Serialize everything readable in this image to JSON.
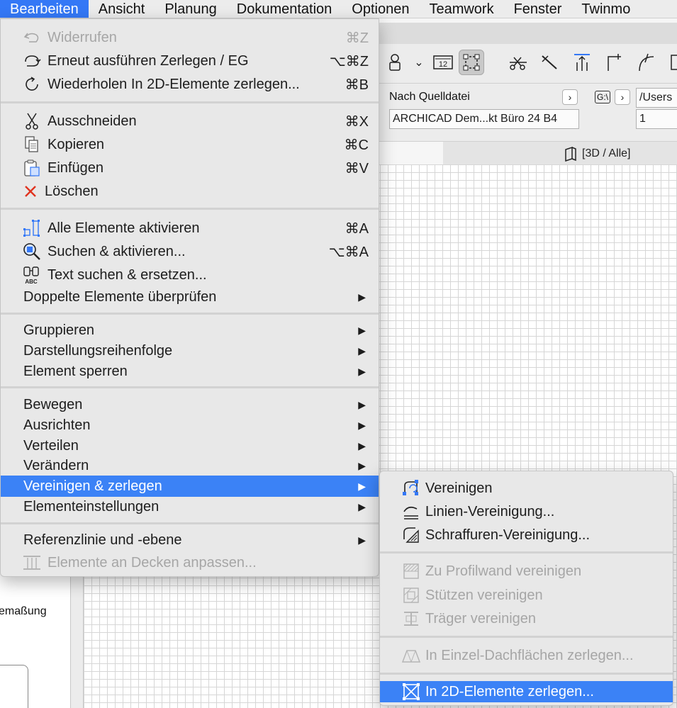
{
  "menubar": {
    "items": [
      {
        "label": "Bearbeiten",
        "active": true
      },
      {
        "label": "Ansicht"
      },
      {
        "label": "Planung"
      },
      {
        "label": "Dokumentation"
      },
      {
        "label": "Optionen"
      },
      {
        "label": "Teamwork"
      },
      {
        "label": "Fenster"
      },
      {
        "label": "Twinmo"
      }
    ]
  },
  "edit_menu": {
    "undo": {
      "label": "Widerrufen",
      "shortcut": "⌘Z",
      "icon": "undo-icon",
      "enabled": false
    },
    "redo": {
      "label": "Erneut ausführen Zerlegen / EG",
      "shortcut": "⌥⌘Z",
      "icon": "redo-icon"
    },
    "repeat": {
      "label": "Wiederholen In 2D-Elemente zerlegen...",
      "shortcut": "⌘B",
      "icon": "repeat-icon"
    },
    "cut": {
      "label": "Ausschneiden",
      "shortcut": "⌘X",
      "icon": "scissors-icon"
    },
    "copy": {
      "label": "Kopieren",
      "shortcut": "⌘C",
      "icon": "copy-icon"
    },
    "paste": {
      "label": "Einfügen",
      "shortcut": "⌘V",
      "icon": "clipboard-icon"
    },
    "delete": {
      "label": "Löschen",
      "icon": "delete-x-icon"
    },
    "select_all": {
      "label": "Alle Elemente aktivieren",
      "shortcut": "⌘A",
      "icon": "select-all-icon"
    },
    "find_select": {
      "label": "Suchen & aktivieren...",
      "shortcut": "⌥⌘A",
      "icon": "find-select-icon"
    },
    "find_text": {
      "label": "Text suchen & ersetzen...",
      "icon": "binoculars-icon",
      "icon_caption": "ABC"
    },
    "duplicates": {
      "label": "Doppelte Elemente überprüfen"
    },
    "group": {
      "label": "Gruppieren"
    },
    "display_order": {
      "label": "Darstellungsreihenfolge"
    },
    "lock": {
      "label": "Element sperren"
    },
    "move": {
      "label": "Bewegen"
    },
    "align": {
      "label": "Ausrichten"
    },
    "distribute": {
      "label": "Verteilen"
    },
    "reshape": {
      "label": "Verändern"
    },
    "merge_explode": {
      "label": "Vereinigen & zerlegen",
      "highlighted": true
    },
    "element_settings": {
      "label": "Elementeinstellungen"
    },
    "reference": {
      "label": "Referenzlinie und -ebene"
    },
    "adjust_slabs": {
      "label": "Elemente an Decken anpassen...",
      "icon": "adjust-slabs-icon",
      "enabled": false
    }
  },
  "submenu": {
    "merge": {
      "label": "Vereinigen",
      "icon": "merge-icon"
    },
    "line_merge": {
      "label": "Linien-Vereinigung...",
      "icon": "line-merge-icon"
    },
    "fill_merge": {
      "label": "Schraffuren-Vereinigung...",
      "icon": "fill-merge-icon"
    },
    "profile_wall": {
      "label": "Zu Profilwand vereinigen",
      "icon": "profile-wall-icon",
      "enabled": false
    },
    "columns": {
      "label": "Stützen vereinigen",
      "icon": "column-icon",
      "enabled": false
    },
    "beams": {
      "label": "Träger vereinigen",
      "icon": "beam-icon",
      "enabled": false
    },
    "roof_planes": {
      "label": "In Einzel-Dachflächen zerlegen...",
      "icon": "roof-icon",
      "enabled": false
    },
    "explode_2d": {
      "label": "In 2D-Elemente zerlegen...",
      "icon": "explode-2d-icon",
      "highlighted": true
    }
  },
  "infobar": {
    "source_label": "Nach Quelldatei",
    "source_value": "ARCHICAD Dem...kt Büro 24 B4",
    "path_value": "/Users",
    "field_value": "1",
    "floor_icon_text": "G:\\"
  },
  "toolbar": {
    "scale_text": "12"
  },
  "view_tab": {
    "label": "[3D / Alle]"
  },
  "left_pane": {
    "text": "emaßung"
  },
  "colors": {
    "highlight": "#3b82f6",
    "menu_bg": "#e8e8e8",
    "disabled_text": "#a6a6a6",
    "delete_red": "#e0331f"
  }
}
